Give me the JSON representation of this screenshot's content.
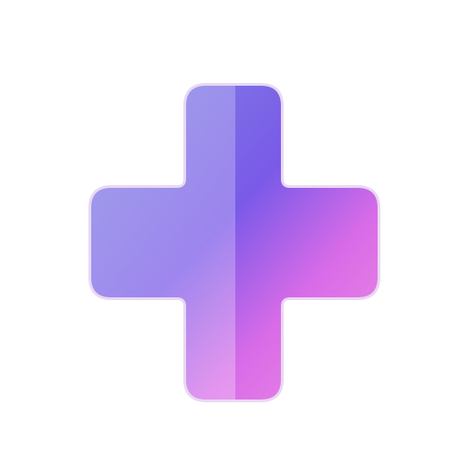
{
  "icon": {
    "name": "plus-icon",
    "colors": {
      "background": "#ffffff",
      "gradient_top_left": "#7f86e2",
      "gradient_top_right": "#7a5ae8",
      "gradient_right": "#d86be8",
      "gradient_bottom": "#f08fe0",
      "highlight_band": "#ffffff",
      "outline": "#e9d8f3"
    }
  }
}
